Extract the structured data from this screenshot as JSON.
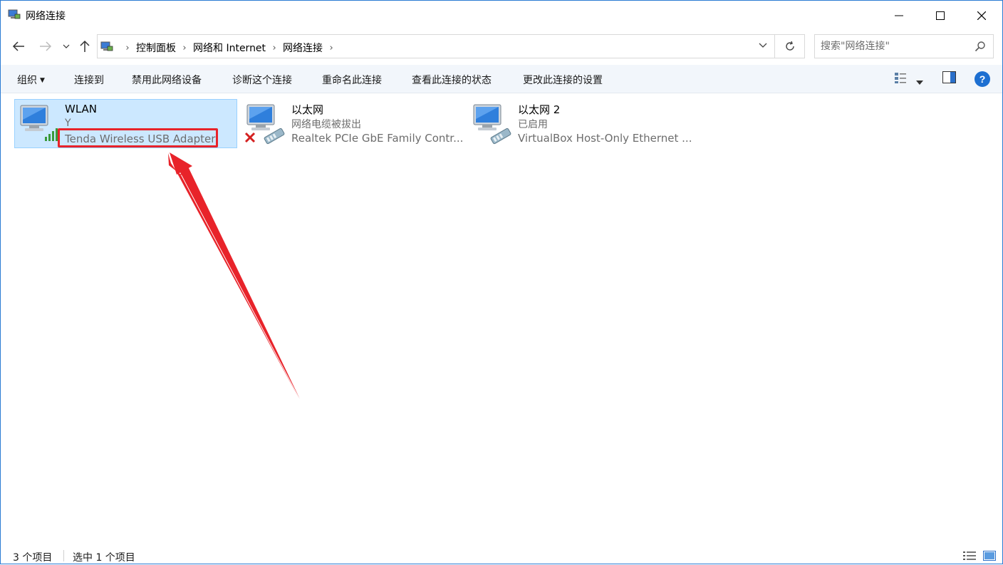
{
  "window": {
    "title": "网络连接",
    "icon": "network-connections-icon"
  },
  "nav": {
    "back_icon": "back-arrow-icon",
    "forward_icon": "forward-arrow-icon",
    "recent_icon": "chevron-down-icon",
    "up_icon": "up-arrow-icon",
    "breadcrumbs": [
      "控制面板",
      "网络和 Internet",
      "网络连接"
    ],
    "search_placeholder": "搜索\"网络连接\""
  },
  "commands": {
    "organize": "组织",
    "connect": "连接到",
    "disable": "禁用此网络设备",
    "diagnose": "诊断这个连接",
    "rename": "重命名此连接",
    "view_status": "查看此连接的状态",
    "change_settings": "更改此连接的设置"
  },
  "items": [
    {
      "name": "WLAN",
      "status": "Y",
      "device": "Tenda Wireless USB Adapter",
      "icon": "wifi-adapter-icon",
      "selected": true
    },
    {
      "name": "以太网",
      "status": "网络电缆被拔出",
      "device": "Realtek PCIe GbE Family Contr...",
      "icon": "ethernet-disconnected-icon",
      "selected": false
    },
    {
      "name": "以太网 2",
      "status": "已启用",
      "device": "VirtualBox Host-Only Ethernet ...",
      "icon": "ethernet-adapter-icon",
      "selected": false
    }
  ],
  "statusbar": {
    "count": "3 个项目",
    "selected": "选中 1 个项目"
  },
  "colors": {
    "accent": "#1d6fd1",
    "selection": "#cce8ff",
    "annotation": "#e8232a"
  }
}
